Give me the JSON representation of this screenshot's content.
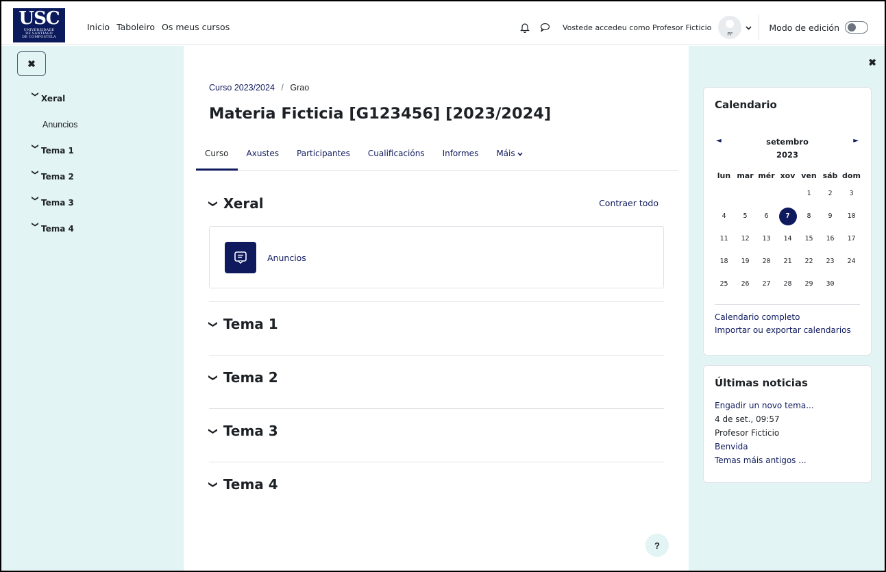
{
  "logo": {
    "letters": "USC",
    "line1": "UNIVERSIDADE",
    "line2": "DE SANTIAGO",
    "line3": "DE COMPOSTELA"
  },
  "nav": {
    "links": [
      "Inicio",
      "Taboleiro",
      "Os meus cursos"
    ],
    "login_text": "Vostede accedeu como Profesor Ficticio",
    "avatar_initials": "PF",
    "edit_mode_label": "Modo de edición"
  },
  "course_index": {
    "sections": [
      {
        "label": "Xeral",
        "items": [
          "Anuncios"
        ]
      },
      {
        "label": "Tema 1",
        "items": []
      },
      {
        "label": "Tema 2",
        "items": []
      },
      {
        "label": "Tema 3",
        "items": []
      },
      {
        "label": "Tema 4",
        "items": []
      }
    ]
  },
  "breadcrumb": {
    "part1": "Curso 2023/2024",
    "separator": "/",
    "part2": "Grao"
  },
  "page_title": "Materia Ficticia [G123456] [2023/2024]",
  "tabs": [
    "Curso",
    "Axustes",
    "Participantes",
    "Cualificacións",
    "Informes",
    "Máis"
  ],
  "collapse_all": "Contraer todo",
  "sections": [
    {
      "title": "Xeral",
      "activities": [
        "Anuncios"
      ]
    },
    {
      "title": "Tema 1"
    },
    {
      "title": "Tema 2"
    },
    {
      "title": "Tema 3"
    },
    {
      "title": "Tema 4"
    }
  ],
  "calendar": {
    "title": "Calendario",
    "month": "setembro",
    "year": "2023",
    "weekdays": [
      "lun",
      "mar",
      "mér",
      "xov",
      "ven",
      "sáb",
      "dom"
    ],
    "weeks": [
      [
        "",
        "",
        "",
        "",
        "1",
        "2",
        "3"
      ],
      [
        "4",
        "5",
        "6",
        "7",
        "8",
        "9",
        "10"
      ],
      [
        "11",
        "12",
        "13",
        "14",
        "15",
        "16",
        "17"
      ],
      [
        "18",
        "19",
        "20",
        "21",
        "22",
        "23",
        "24"
      ],
      [
        "25",
        "26",
        "27",
        "28",
        "29",
        "30",
        ""
      ]
    ],
    "today": "7",
    "full_link": "Calendario completo",
    "import_link": "Importar ou exportar calendarios"
  },
  "news": {
    "title": "Últimas noticias",
    "add_link": "Engadir un novo tema...",
    "date": "4 de set., 09:57",
    "author": "Profesor Ficticio",
    "post_link": "Benvida",
    "older_link": "Temas máis antigos ..."
  },
  "colors": {
    "brand": "#0f1a5e",
    "drawer_bg": "#e3f4f4"
  },
  "help_label": "?"
}
